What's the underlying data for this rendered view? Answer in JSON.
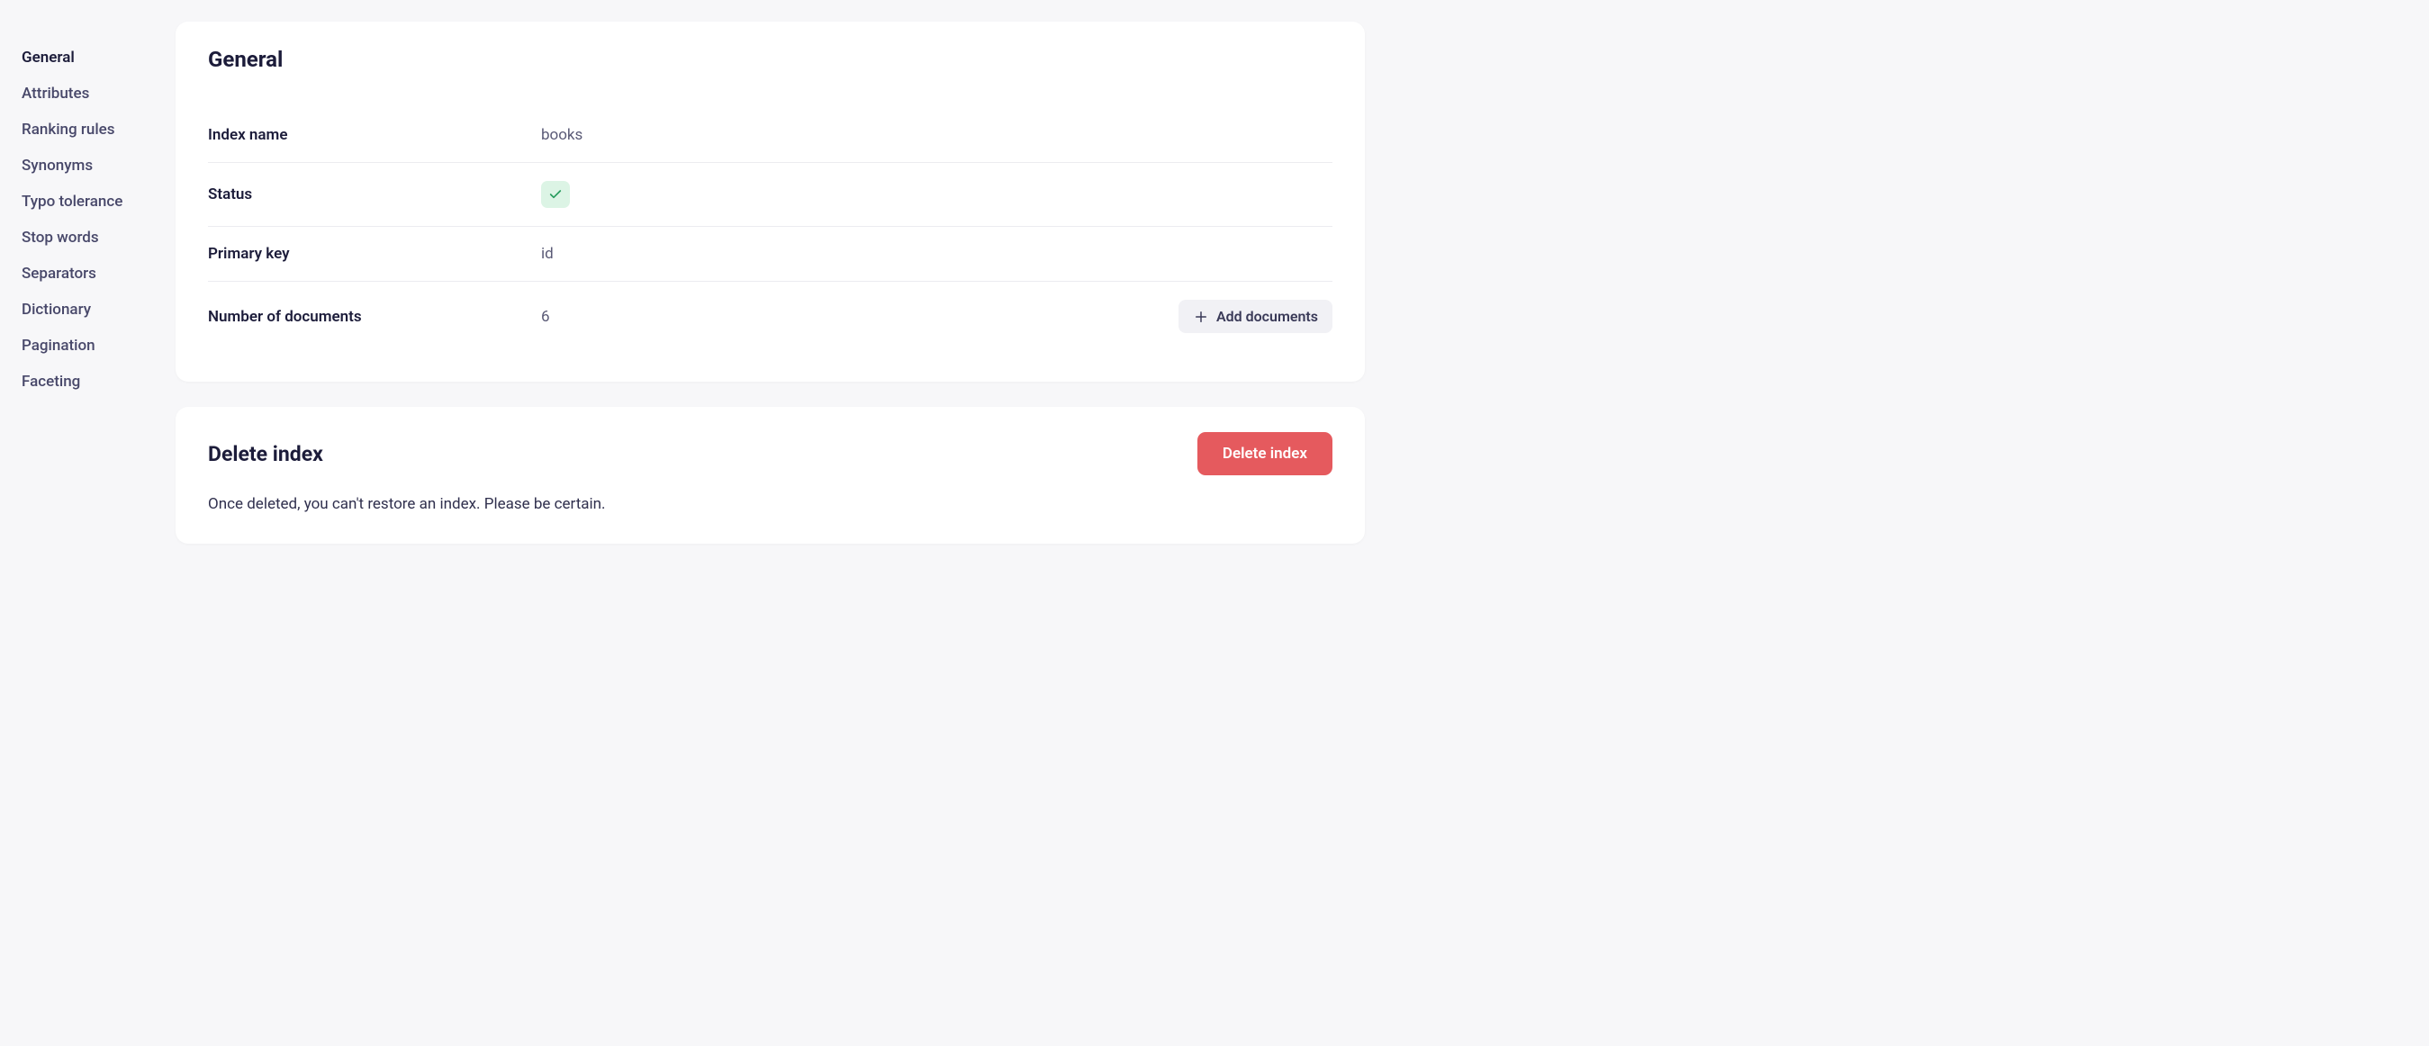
{
  "sidebar": {
    "items": [
      {
        "label": "General",
        "active": true
      },
      {
        "label": "Attributes",
        "active": false
      },
      {
        "label": "Ranking rules",
        "active": false
      },
      {
        "label": "Synonyms",
        "active": false
      },
      {
        "label": "Typo tolerance",
        "active": false
      },
      {
        "label": "Stop words",
        "active": false
      },
      {
        "label": "Separators",
        "active": false
      },
      {
        "label": "Dictionary",
        "active": false
      },
      {
        "label": "Pagination",
        "active": false
      },
      {
        "label": "Faceting",
        "active": false
      }
    ]
  },
  "general": {
    "title": "General",
    "index_name_label": "Index name",
    "index_name_value": "books",
    "status_label": "Status",
    "status_ok": true,
    "primary_key_label": "Primary key",
    "primary_key_value": "id",
    "num_documents_label": "Number of documents",
    "num_documents_value": "6",
    "add_documents_label": "Add documents"
  },
  "delete": {
    "title": "Delete index",
    "button_label": "Delete index",
    "warning_text": "Once deleted, you can't restore an index. Please be certain."
  }
}
